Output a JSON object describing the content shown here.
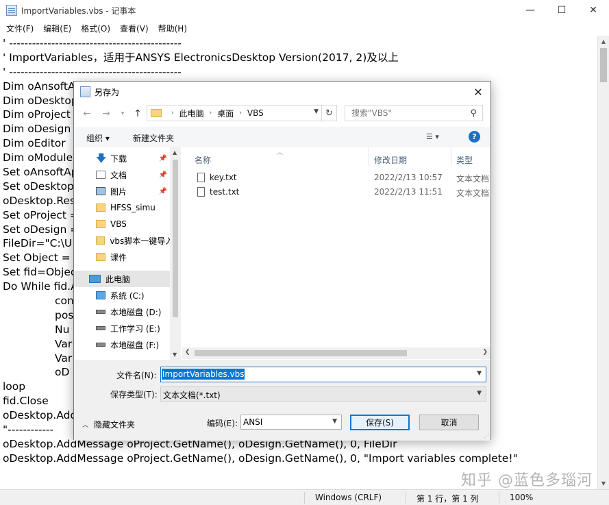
{
  "window": {
    "title": "ImportVariables.vbs - 记事本",
    "controls": [
      "—",
      "☐",
      "✕"
    ]
  },
  "menu": [
    "文件(F)",
    "编辑(E)",
    "格式(O)",
    "查看(V)",
    "帮助(H)"
  ],
  "editor_lines": [
    "' ---------------------------------------------",
    "' ImportVariables，适用于ANSYS ElectronicsDesktop Version(2017, 2)及以上",
    "' ---------------------------------------------",
    "Dim oAnsoftApp",
    "Dim oDesktop",
    "Dim oProject",
    "Dim oDesign",
    "Dim oEditor",
    "Dim oModule",
    "Set oAnsoftApp",
    "Set oDesktop",
    "oDesktop.Res",
    "Set oProject =",
    "Set oDesign =",
    "FileDir=\"C:\\U",
    "Set Object = C",
    "Set fid=Objec",
    "Do While fid.A",
    "\t\tcon",
    "\t\tpos",
    "\t\tNu",
    "\t\tVar",
    "\t\tVar",
    "\t\toD",
    "loop",
    "fid.Close",
    "oDesktop.Add",
    "\"------------",
    "oDesktop.AddMessage oProject.GetName(), oDesign.GetName(), 0, FileDir",
    "oDesktop.AddMessage oProject.GetName(), oDesign.GetName(), 0, \"Import variables complete!\""
  ],
  "status": {
    "line_ending": "Windows (CRLF)",
    "position": "第 1 行，第 1 列",
    "zoom": "100%"
  },
  "watermark": "知乎 @蓝色多瑙河",
  "dialog": {
    "title": "另存为",
    "nav_back": "←",
    "nav_forward": "→",
    "nav_up": "↑",
    "breadcrumbs": [
      "此电脑",
      "桌面",
      "VBS"
    ],
    "search_placeholder": "搜索\"VBS\"",
    "toolbar": {
      "organize": "组织 ▾",
      "new_folder": "新建文件夹",
      "view": "☰ ▾",
      "help": "?"
    },
    "nav_items": [
      {
        "label": "下载",
        "icon": "download-icon",
        "pinned": true
      },
      {
        "label": "文档",
        "icon": "document-icon",
        "pinned": true
      },
      {
        "label": "图片",
        "icon": "picture-icon",
        "pinned": true
      },
      {
        "label": "HFSS_simu",
        "icon": "folder-icon",
        "pinned": false
      },
      {
        "label": "VBS",
        "icon": "folder-icon",
        "pinned": false
      },
      {
        "label": "vbs脚本一键导入",
        "icon": "folder-icon",
        "pinned": false
      },
      {
        "label": "课件",
        "icon": "folder-icon",
        "pinned": false
      },
      {
        "label": "此电脑",
        "icon": "computer-icon",
        "pinned": false,
        "selected": true
      },
      {
        "label": "系统 (C:)",
        "icon": "system-drive-icon",
        "pinned": false
      },
      {
        "label": "本地磁盘 (D:)",
        "icon": "drive-icon",
        "pinned": false
      },
      {
        "label": "工作学习 (E:)",
        "icon": "drive-icon",
        "pinned": false
      },
      {
        "label": "本地磁盘 (F:)",
        "icon": "drive-icon",
        "pinned": false
      }
    ],
    "columns": [
      "名称",
      "修改日期",
      "类型"
    ],
    "files": [
      {
        "name": "key.txt",
        "date": "2022/2/13 10:57",
        "type": "文本文档"
      },
      {
        "name": "test.txt",
        "date": "2022/2/13 11:51",
        "type": "文本文档"
      }
    ],
    "filename_label": "文件名(N):",
    "filename_value": "ImportVariables.vbs",
    "filetype_label": "保存类型(T):",
    "filetype_value": "文本文档(*.txt)",
    "hide_folders": "隐藏文件夹",
    "encoding_label": "编码(E):",
    "encoding_value": "ANSI",
    "save_button": "保存(S)",
    "cancel_button": "取消"
  }
}
